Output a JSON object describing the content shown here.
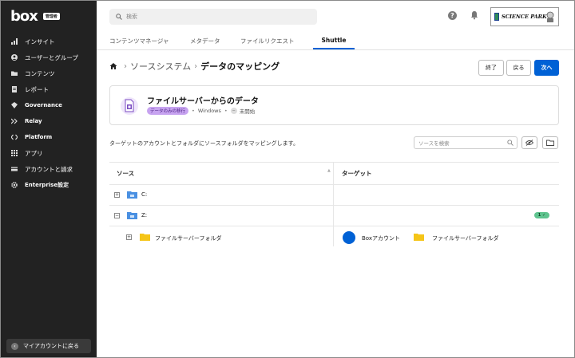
{
  "sidebar": {
    "logo": "box",
    "admin_badge": "管理者",
    "items": [
      {
        "label": "インサイト",
        "icon": "bar-chart-icon"
      },
      {
        "label": "ユーザーとグループ",
        "icon": "users-icon"
      },
      {
        "label": "コンテンツ",
        "icon": "folder-icon"
      },
      {
        "label": "レポート",
        "icon": "report-icon"
      },
      {
        "label": "Governance",
        "icon": "governance-icon"
      },
      {
        "label": "Relay",
        "icon": "relay-icon"
      },
      {
        "label": "Platform",
        "icon": "platform-icon"
      },
      {
        "label": "アプリ",
        "icon": "apps-grid-icon"
      },
      {
        "label": "アカウントと請求",
        "icon": "billing-icon"
      },
      {
        "label": "Enterprise設定",
        "icon": "gear-icon"
      }
    ],
    "my_account": "マイアカウントに戻る"
  },
  "topbar": {
    "search_placeholder": "検索",
    "help": "?",
    "org_logo": "SCIENCE PARK"
  },
  "tabs": [
    {
      "label": "コンテンツマネージャ"
    },
    {
      "label": "メタデータ"
    },
    {
      "label": "ファイルリクエスト"
    },
    {
      "label": "Shuttle",
      "active": true
    }
  ],
  "breadcrumb": {
    "parent": "ソースシステム",
    "current": "データのマッピング"
  },
  "actions": {
    "end": "終了",
    "back": "戻る",
    "next": "次へ"
  },
  "card": {
    "title": "ファイルサーバーからのデータ",
    "badge": "データのみの移行",
    "platform": "Windows",
    "status": "未開始"
  },
  "description": "ターゲットのアカウントとフォルダにソースフォルダをマッピングします。",
  "filter_placeholder": "ソースを検索",
  "table": {
    "headers": {
      "source": "ソース",
      "target": "ターゲット"
    },
    "rows": [
      {
        "source": "C:",
        "expander": "+"
      },
      {
        "source": "Z:",
        "expander": "−",
        "badge": "1 ✓"
      },
      {
        "source": "ファイルサーバーフォルダ",
        "expander": "+",
        "target_account": "Boxアカウント",
        "target_folder": "ファイルサーバーフォルダ"
      }
    ]
  },
  "colors": {
    "sidebar_bg": "#222222",
    "accent": "#0061d5",
    "badge_purple": "#c7a3f0",
    "success": "#5fc48f",
    "folder_yellow": "#f5c518"
  }
}
